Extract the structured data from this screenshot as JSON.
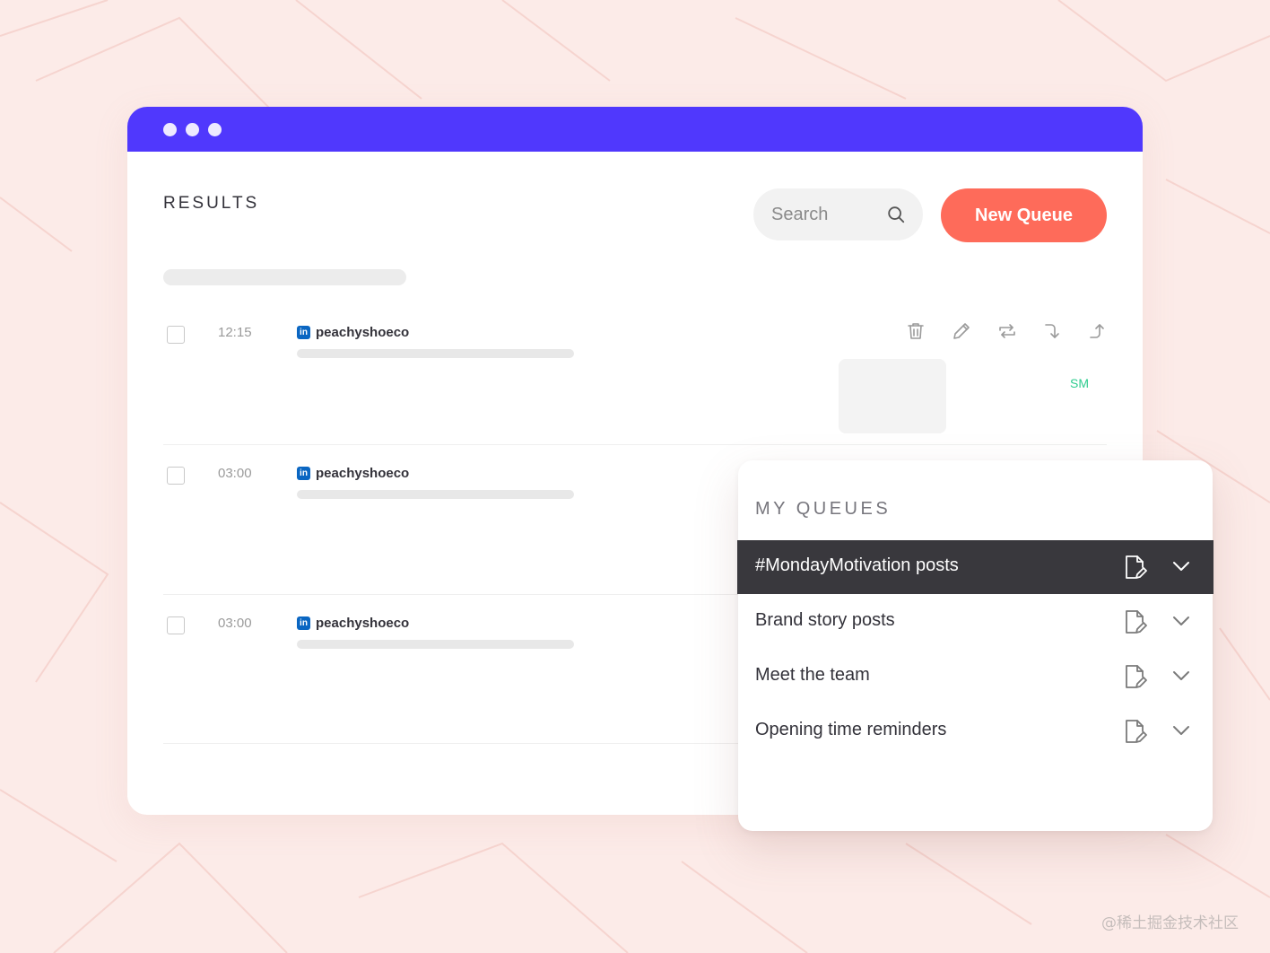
{
  "results": {
    "title": "RESULTS",
    "search_placeholder": "Search",
    "new_queue_label": "New Queue",
    "posts": [
      {
        "time": "12:15",
        "network_icon": "linkedin-icon",
        "network_abbr": "in",
        "account": "peachyshoeco",
        "badge": "SM"
      },
      {
        "time": "03:00",
        "network_icon": "linkedin-icon",
        "network_abbr": "in",
        "account": "peachyshoeco"
      },
      {
        "time": "03:00",
        "network_icon": "linkedin-icon",
        "network_abbr": "in",
        "account": "peachyshoeco"
      }
    ],
    "row_actions": [
      "trash-icon",
      "pencil-icon",
      "repost-icon",
      "reply-icon",
      "share-icon"
    ]
  },
  "queues": {
    "title": "MY QUEUES",
    "items": [
      {
        "label": "#MondayMotivation posts",
        "active": true
      },
      {
        "label": "Brand story posts",
        "active": false
      },
      {
        "label": "Meet the team",
        "active": false
      },
      {
        "label": "Opening time reminders",
        "active": false
      }
    ]
  },
  "colors": {
    "titlebar": "#5038fd",
    "accent_button": "#fe6b5a",
    "active_queue": "#39383d",
    "background": "#fcebe8",
    "badge": "#2ecc8f"
  },
  "watermark": "@稀土掘金技术社区"
}
